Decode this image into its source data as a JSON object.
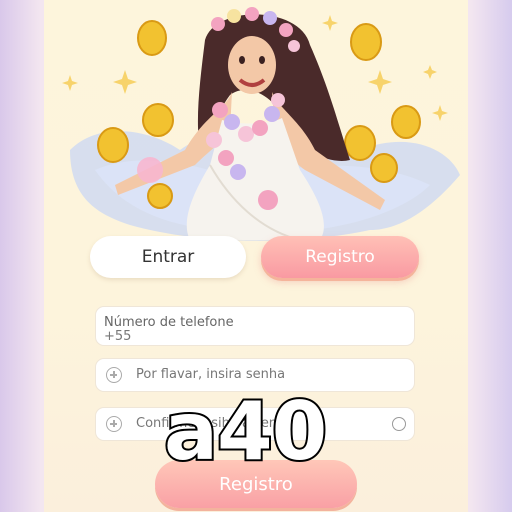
{
  "tabs": {
    "login_label": "Entrar",
    "register_label": "Registro"
  },
  "form": {
    "phone_label": "Número de telefone",
    "phone_prefix": "+55",
    "password_placeholder": "Por flavar, insira senha",
    "confirm_placeholder": "Confirme insiha a senha",
    "submit_label": "Registro"
  },
  "overlay_text": "a40",
  "colors": {
    "accent": "#f99aa2",
    "background": "#fdf5dc",
    "coin": "#f2c230"
  }
}
